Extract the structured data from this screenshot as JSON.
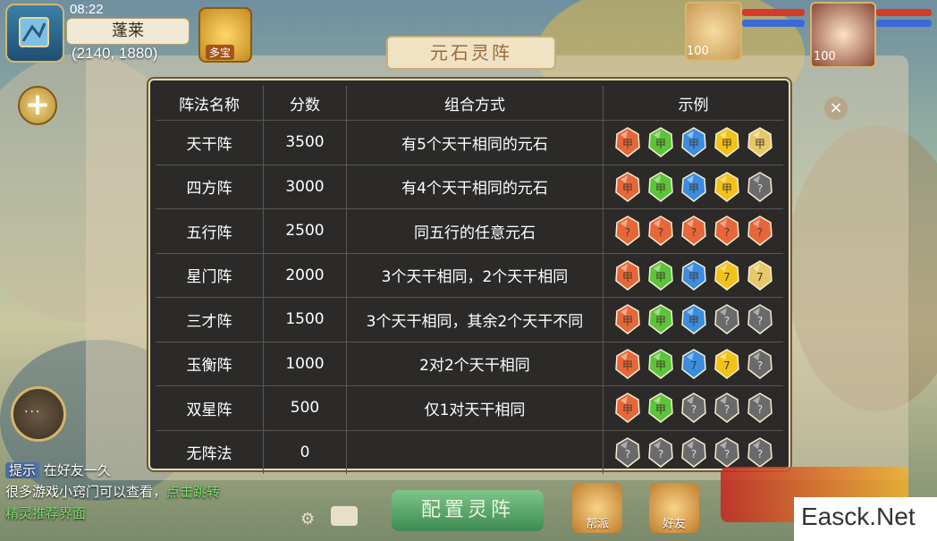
{
  "hud": {
    "time": "08:22",
    "location_name": "蓬莱",
    "coordinates": "(2140, 1880)",
    "treasure_label": "多宝",
    "pet_level": "100",
    "hero_level": "100"
  },
  "panel": {
    "title": "元石灵阵",
    "config_button": "配置灵阵"
  },
  "table": {
    "headers": [
      "阵法名称",
      "分数",
      "组合方式",
      "示例"
    ],
    "rows": [
      {
        "name": "天干阵",
        "score": "3500",
        "combo": "有5个天干相同的元石",
        "gems": [
          {
            "color": "red",
            "mark": "甲"
          },
          {
            "color": "green",
            "mark": "甲"
          },
          {
            "color": "blue",
            "mark": "甲"
          },
          {
            "color": "yellow",
            "mark": "甲"
          },
          {
            "color": "gold",
            "mark": "甲"
          }
        ]
      },
      {
        "name": "四方阵",
        "score": "3000",
        "combo": "有4个天干相同的元石",
        "gems": [
          {
            "color": "red",
            "mark": "甲"
          },
          {
            "color": "green",
            "mark": "甲"
          },
          {
            "color": "blue",
            "mark": "甲"
          },
          {
            "color": "yellow",
            "mark": "甲"
          },
          {
            "color": "gray",
            "mark": "?"
          }
        ]
      },
      {
        "name": "五行阵",
        "score": "2500",
        "combo": "同五行的任意元石",
        "gems": [
          {
            "color": "red",
            "mark": "?"
          },
          {
            "color": "red",
            "mark": "?"
          },
          {
            "color": "red",
            "mark": "?"
          },
          {
            "color": "red",
            "mark": "?"
          },
          {
            "color": "red",
            "mark": "?"
          }
        ]
      },
      {
        "name": "星门阵",
        "score": "2000",
        "combo": "3个天干相同，2个天干相同",
        "gems": [
          {
            "color": "red",
            "mark": "甲"
          },
          {
            "color": "green",
            "mark": "甲"
          },
          {
            "color": "blue",
            "mark": "甲"
          },
          {
            "color": "yellow",
            "mark": "7"
          },
          {
            "color": "gold",
            "mark": "7"
          }
        ]
      },
      {
        "name": "三才阵",
        "score": "1500",
        "combo": "3个天干相同，其余2个天干不同",
        "gems": [
          {
            "color": "red",
            "mark": "甲"
          },
          {
            "color": "green",
            "mark": "甲"
          },
          {
            "color": "blue",
            "mark": "甲"
          },
          {
            "color": "gray",
            "mark": "?"
          },
          {
            "color": "gray",
            "mark": "?"
          }
        ]
      },
      {
        "name": "玉衡阵",
        "score": "1000",
        "combo": "2对2个天干相同",
        "gems": [
          {
            "color": "red",
            "mark": "甲"
          },
          {
            "color": "green",
            "mark": "甲"
          },
          {
            "color": "blue",
            "mark": "7"
          },
          {
            "color": "yellow",
            "mark": "7"
          },
          {
            "color": "gray",
            "mark": "?"
          }
        ]
      },
      {
        "name": "双星阵",
        "score": "500",
        "combo": "仅1对天干相同",
        "gems": [
          {
            "color": "red",
            "mark": "甲"
          },
          {
            "color": "green",
            "mark": "甲"
          },
          {
            "color": "gray",
            "mark": "?"
          },
          {
            "color": "gray",
            "mark": "?"
          },
          {
            "color": "gray",
            "mark": "?"
          }
        ]
      },
      {
        "name": "无阵法",
        "score": "0",
        "combo": "",
        "gems": [
          {
            "color": "gray",
            "mark": "?"
          },
          {
            "color": "gray",
            "mark": "?"
          },
          {
            "color": "gray",
            "mark": "?"
          },
          {
            "color": "gray",
            "mark": "?"
          },
          {
            "color": "gray",
            "mark": "?"
          }
        ]
      }
    ]
  },
  "chat": {
    "line1_tag": "提示",
    "line1_text": "在好友一久",
    "line2_text": "很多游戏小窍门可以查看，",
    "line2_link": "点击跳转",
    "line3_link": "精灵推荐界面"
  },
  "bottom": {
    "icon1_label": "帮派",
    "icon2_label": "好友"
  },
  "watermark": "Easck.Net",
  "gem_colors": {
    "red": "#e8673a",
    "green": "#5cc43a",
    "blue": "#3a8de0",
    "yellow": "#f2c21a",
    "gold": "#e6c86a",
    "gray": "#6a6a6a"
  }
}
